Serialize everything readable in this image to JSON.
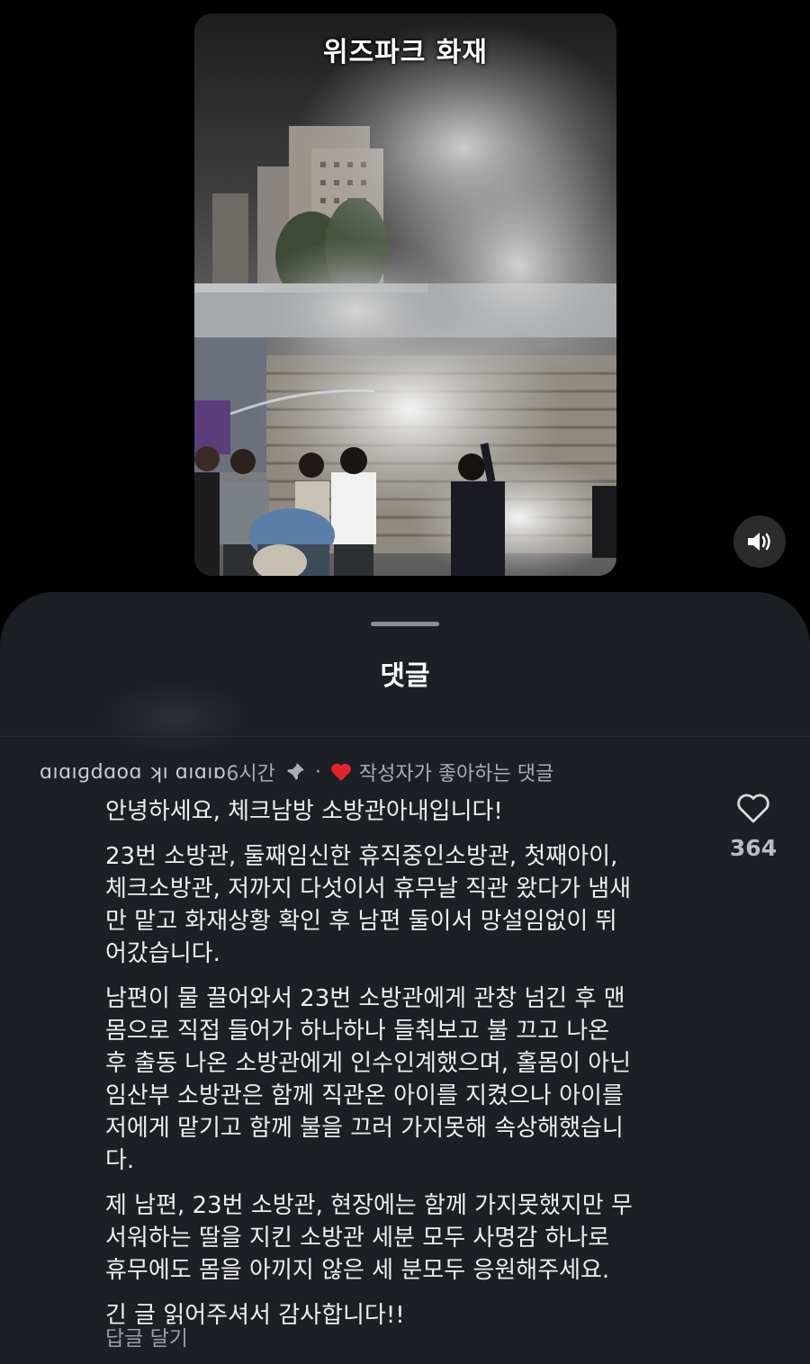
{
  "video": {
    "caption": "위즈파크 화재",
    "mute_icon": "speaker-icon"
  },
  "sheet": {
    "title": "댓글"
  },
  "comment": {
    "username": "ɑıɑıɡdɑoɑ ʞı ɑıɑıɒ",
    "time": "6시간",
    "pin_icon": "pin-icon",
    "separator": "·",
    "liked_by_author": "작성자가 좋아하는 댓글",
    "paragraphs": [
      "안녕하세요, 체크남방 소방관아내입니다!",
      "23번 소방관, 둘째임신한 휴직중인소방관, 첫째아이,\n체크소방관, 저까지 다섯이서 휴무날 직관 왔다가 냄새\n만 맡고 화재상황 확인 후 남편 둘이서 망설임없이 뛰\n어갔습니다.",
      "남편이 물 끌어와서 23번 소방관에게 관창 넘긴 후 맨\n몸으로 직접 들어가 하나하나 들춰보고 불 끄고 나온\n후 출동 나온 소방관에게 인수인계했으며, 홀몸이 아닌\n임산부 소방관은 함께 직관온 아이를 지켰으나 아이를\n저에게 맡기고 함께 불을 끄러 가지못해 속상해했습니\n다.",
      "제 남편, 23번 소방관, 현장에는 함께 가지못했지만 무\n서워하는 딸을 지킨 소방관 세분 모두 사명감 하나로\n휴무에도 몸을 아끼지 않은 세 분모두 응원해주세요.",
      "긴 글 읽어주셔서 감사합니다!!"
    ],
    "like_count": "364",
    "reply_label": "답글 달기"
  },
  "colors": {
    "sheet_bg": "#1c1f24",
    "heart_red": "#e0242e",
    "muted_text": "#a9acb1"
  }
}
